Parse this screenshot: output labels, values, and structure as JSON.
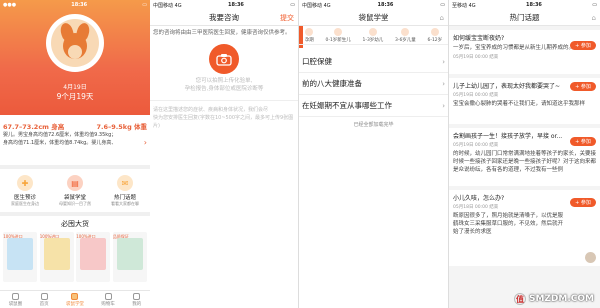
{
  "panel1": {
    "status": {
      "time": "18:36"
    },
    "date": "4月19日",
    "age": "9个月19天",
    "left_text": [
      "婴儿",
      "(身体",
      "成长"
    ],
    "height_range": "67.7–73.2cm 身高",
    "weight_range": "7.6–9.5kg 体重",
    "height_note": "婴儿。男宝身高均值72.6厘米，体重均值9.35kg；",
    "weight_note": "身高均值71.1厘米，体重均值8.74kg。婴儿身高、",
    "features": [
      {
        "label": "医生预诊",
        "sub": "家庭医生在身边",
        "icon": "doctor-icon",
        "color": "#f7a43a"
      },
      {
        "label": "袋鼠学堂",
        "sub": "母婴知识一目了然",
        "icon": "book-icon",
        "color": "#f05a2a"
      },
      {
        "label": "热门话题",
        "sub": "看看大家都在聊",
        "icon": "chat-icon",
        "color": "#f7a43a"
      }
    ],
    "section_title": "必囤大货",
    "goods": [
      {
        "tag": "100%进口",
        "color": "#c7e3f4"
      },
      {
        "tag": "100%进口",
        "color": "#f6e2a8"
      },
      {
        "tag": "100%进口",
        "color": "#f7c8c8"
      },
      {
        "tag": "品质保证",
        "color": "#cfe8d8"
      }
    ],
    "tabs": [
      "袋鼠圈",
      "首页",
      "袋鼠学堂",
      "购物车",
      "我的"
    ],
    "active_tab": 2
  },
  "panel2": {
    "status": {
      "carrier": "中国移动",
      "net": "4G",
      "time": "18:36"
    },
    "title": "我要咨询",
    "submit": "提交",
    "intro": "您的咨询将由由三甲医院医生回复，健康咨询仅供参考。",
    "hint_line1": "您可以拍照上传化验单,",
    "hint_line2": "孕检报告,身体部位或医院诊断等",
    "footer1": "请在这里描述您的症状、疾病和身体状况，我们会尽",
    "footer2": "快为您安排医生回复(字数在10~500字之间，最多可上传9张图片)"
  },
  "panel3": {
    "status": {
      "carrier": "中国移动",
      "net": "4G",
      "time": "18:36"
    },
    "title": "袋鼠学堂",
    "age_tabs": [
      "孕期",
      "0-1岁新生儿",
      "1-3岁幼儿",
      "3-6岁儿童",
      "6-12岁"
    ],
    "topics": [
      "口腔保健",
      "前的八大健康准备",
      "在妊娠期不宜从事哪些工作"
    ],
    "loaded": "已经全部加载完毕"
  },
  "panel4": {
    "status": {
      "carrier": "至移动",
      "net": "4G",
      "time": "18:36"
    },
    "title": "热门话题",
    "follow_label": "+ 参加",
    "posts": [
      {
        "title": "如何缓宝宝断夜奶?",
        "meta": "05月19日 00:00 结束",
        "body": "一岁后，宝宝养成的习惯都是从新生儿期养成的。"
      },
      {
        "title": "儿子上幼儿园了，表现太好我都要哭了~",
        "meta": "05月19日 00:00 结束",
        "body": "宝宝会撒心裂肺的哭着不让我们走，请知道这乎我那样"
      },
      {
        "title": "会割画孩子一生！接孩子放学，早接 or...",
        "meta": "05月19日 00:00 结束",
        "body": "的时候，幼儿园门口常常满满地挂着等孩子的家长，关要接时候一些接孩子回家还是晚一些接孩子好呢？对于这向来都是众说纷纭，各有各的道理，不过我有一些例"
      },
      {
        "title": "小儿久咳，怎么办?",
        "meta": "05月18日 00:00 结束",
        "body": "断原因很多了，照月始就是清嗓子，以优是服鹤珠女三采集服草口服的，不见效，然后就开始了漫长的求医"
      }
    ],
    "watermark": "SMZDM.COM",
    "watermark_badge": "值"
  }
}
